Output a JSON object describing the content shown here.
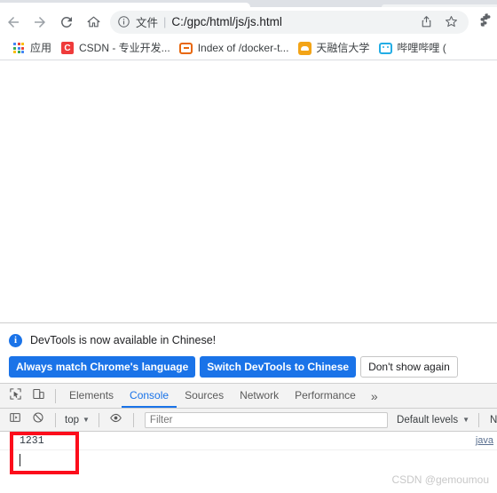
{
  "browser": {
    "nav": {
      "back_title": "Back",
      "forward_title": "Forward",
      "reload_title": "Reload",
      "home_title": "Home"
    },
    "omnibox": {
      "security_icon": "info-circle-icon",
      "scheme_label": "文件",
      "separator": "|",
      "url": "C:/gpc/html/js/js.html"
    },
    "omnibox_actions": {
      "share_title": "Share this page",
      "bookmark_title": "Bookmark this tab"
    },
    "extensions_title": "Extensions",
    "bookmarks": [
      {
        "label": "应用",
        "icon": "apps-grid-icon"
      },
      {
        "label": "CSDN - 专业开发...",
        "icon": "csdn-icon",
        "icon_text": "C",
        "icon_color": "#ef3b3b"
      },
      {
        "label": "Index of /docker-t...",
        "icon": "docker-index-icon",
        "icon_color": "#e8670c"
      },
      {
        "label": "天融信大学",
        "icon": "cloud-icon",
        "icon_color": "#f3a417"
      },
      {
        "label": "哔哩哔哩 (",
        "icon": "bilibili-icon",
        "icon_color": "#23ade5"
      }
    ]
  },
  "devtools": {
    "banner": {
      "info_icon": "info-icon",
      "message": "DevTools is now available in Chinese!",
      "primary_button": "Always match Chrome's language",
      "secondary_button": "Switch DevTools to Chinese",
      "dismiss_button": "Don't show again"
    },
    "toolbar": {
      "inspect_title": "Inspect element",
      "device_toggle_title": "Toggle device toolbar",
      "more_tabs": "»"
    },
    "tabs": [
      {
        "label": "Elements",
        "active": false
      },
      {
        "label": "Console",
        "active": true
      },
      {
        "label": "Sources",
        "active": false
      },
      {
        "label": "Network",
        "active": false
      },
      {
        "label": "Performance",
        "active": false
      }
    ],
    "console_toolbar": {
      "sidebar_toggle_title": "Show console sidebar",
      "clear_title": "Clear console",
      "context": "top",
      "eye_title": "Create live expression",
      "filter_placeholder": "Filter",
      "filter_value": "",
      "levels": "Default levels",
      "issues": "N"
    },
    "console": {
      "logs": [
        {
          "text": "1231",
          "source": "java"
        }
      ],
      "prompt_arrow": "›",
      "prompt_value": ""
    }
  },
  "annotation": {
    "box_color": "#fc0d1b"
  },
  "watermark": "CSDN @gemoumou"
}
